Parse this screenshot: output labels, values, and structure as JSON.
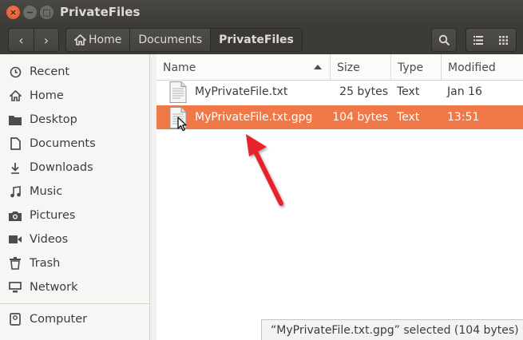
{
  "window": {
    "title": "PrivateFiles",
    "close_glyph": "×",
    "minimize_glyph": "−",
    "maximize_glyph": "□"
  },
  "toolbar": {
    "back_glyph": "‹",
    "forward_glyph": "›",
    "breadcrumbs": [
      "Home",
      "Documents",
      "PrivateFiles"
    ]
  },
  "sidebar": {
    "items": [
      {
        "label": "Recent",
        "icon": "clock-icon"
      },
      {
        "label": "Home",
        "icon": "home-icon"
      },
      {
        "label": "Desktop",
        "icon": "folder-icon"
      },
      {
        "label": "Documents",
        "icon": "document-icon"
      },
      {
        "label": "Downloads",
        "icon": "download-icon"
      },
      {
        "label": "Music",
        "icon": "music-icon"
      },
      {
        "label": "Pictures",
        "icon": "camera-icon"
      },
      {
        "label": "Videos",
        "icon": "video-icon"
      },
      {
        "label": "Trash",
        "icon": "trash-icon"
      },
      {
        "label": "Network",
        "icon": "network-icon"
      },
      {
        "label": "Computer",
        "icon": "computer-icon"
      }
    ]
  },
  "file_list": {
    "columns": {
      "name": "Name",
      "size": "Size",
      "type": "Type",
      "modified": "Modified"
    },
    "rows": [
      {
        "name": "MyPrivateFile.txt",
        "size": "25 bytes",
        "type": "Text",
        "modified": "Jan 16",
        "selected": false
      },
      {
        "name": "MyPrivateFile.txt.gpg",
        "size": "104 bytes",
        "type": "Text",
        "modified": "13:51",
        "selected": true
      }
    ]
  },
  "status": {
    "text": "“MyPrivateFile.txt.gpg” selected  (104 bytes)"
  },
  "colors": {
    "selection": "#f07746",
    "titlebar": "#3c3b37",
    "close_button": "#e1522a",
    "annotation_arrow": "#e8202a"
  }
}
